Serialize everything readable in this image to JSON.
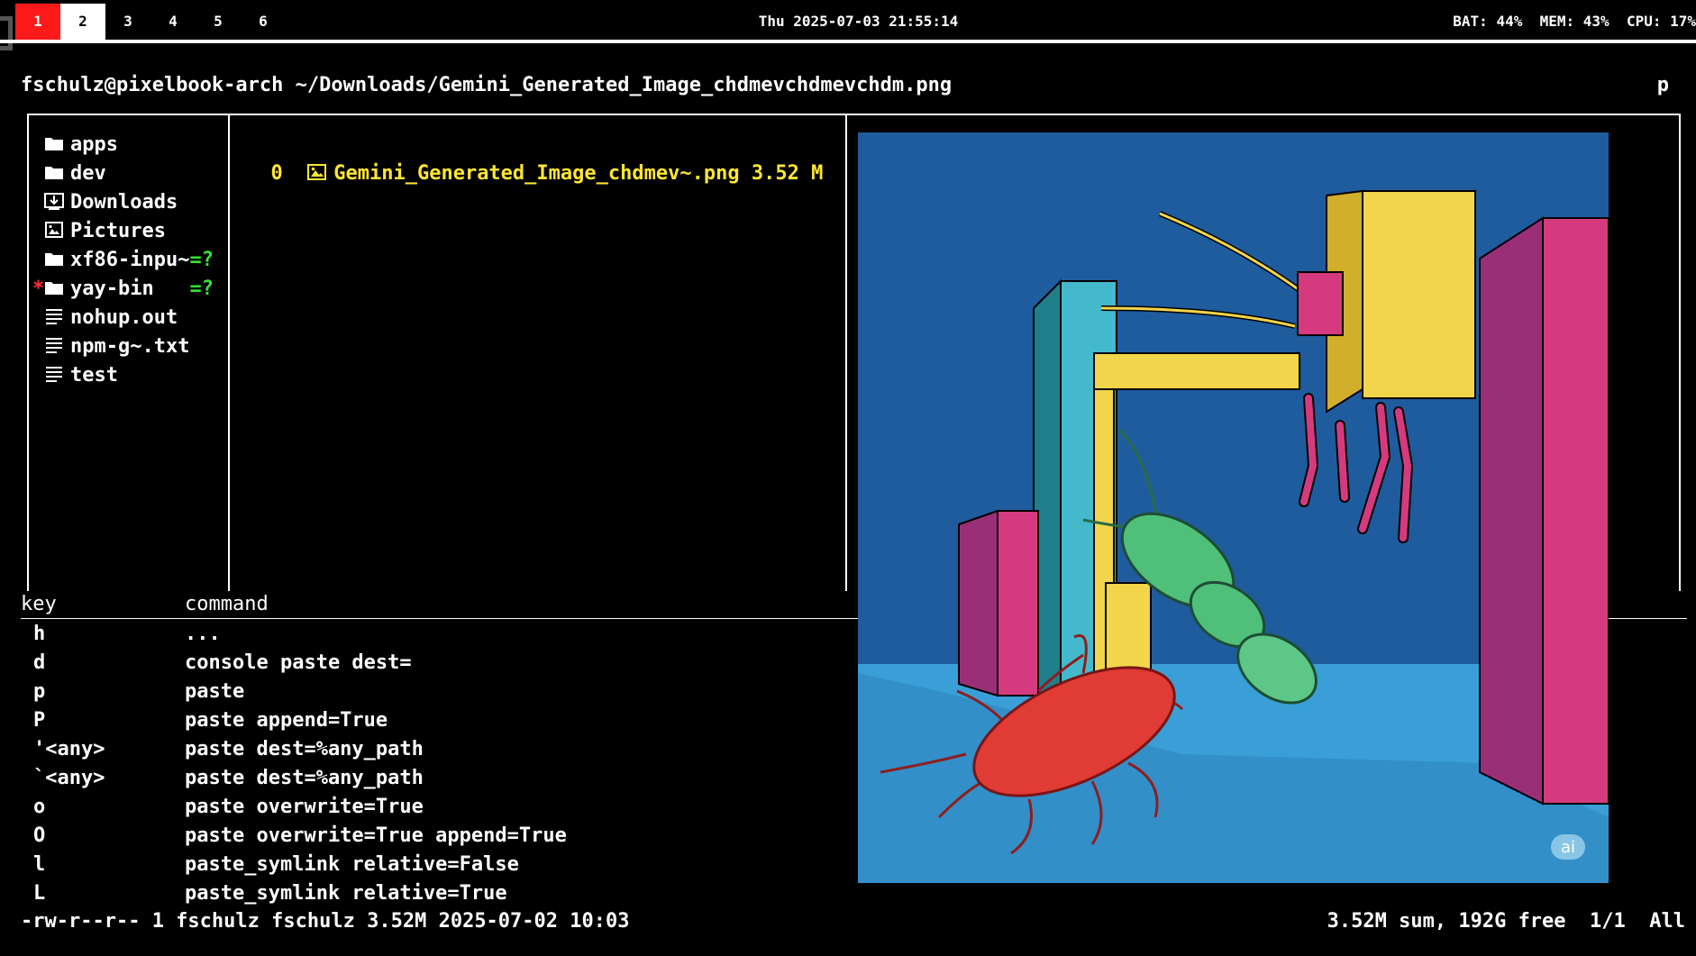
{
  "workspaces": [
    {
      "label": "1",
      "state": "active"
    },
    {
      "label": "2",
      "state": "visible"
    },
    {
      "label": "3",
      "state": "normal"
    },
    {
      "label": "4",
      "state": "normal"
    },
    {
      "label": "5",
      "state": "normal"
    },
    {
      "label": "6",
      "state": "normal"
    }
  ],
  "clock": "Thu 2025-07-03  21:55:14",
  "status": "BAT: 44%  MEM: 43%  CPU: 17%",
  "ranger": {
    "title": "fschulz@pixelbook-arch ~/Downloads/Gemini_Generated_Image_chdmevchdmevchdm.png",
    "title_right": "p",
    "parent_items": [
      {
        "name": "apps",
        "icon": "folder-icon",
        "suffix": "",
        "mark": ""
      },
      {
        "name": "dev",
        "icon": "folder-icon",
        "suffix": "",
        "mark": ""
      },
      {
        "name": "Downloads",
        "icon": "downloads-icon",
        "suffix": "",
        "mark": ""
      },
      {
        "name": "Pictures",
        "icon": "pictures-icon",
        "suffix": "",
        "mark": ""
      },
      {
        "name": "xf86-inpu~",
        "icon": "folder-icon",
        "suffix": "=?",
        "mark": ""
      },
      {
        "name": "yay-bin   ",
        "icon": "folder-icon",
        "suffix": "=?",
        "mark": "*"
      },
      {
        "name": "nohup.out",
        "icon": "text-file-icon",
        "suffix": "",
        "mark": ""
      },
      {
        "name": "npm-g~.txt",
        "icon": "text-file-icon",
        "suffix": "",
        "mark": ""
      },
      {
        "name": "test",
        "icon": "text-file-icon",
        "suffix": "",
        "mark": ""
      }
    ],
    "current": {
      "index": "0",
      "name": "Gemini_Generated_Image_chdmev~.png",
      "size": "3.52 M",
      "icon": "image-file-icon"
    },
    "help_header": {
      "key": "key",
      "command": "command"
    },
    "help_rows": [
      {
        "key": "h",
        "command": "..."
      },
      {
        "key": "d",
        "command": "console paste dest="
      },
      {
        "key": "p",
        "command": "paste"
      },
      {
        "key": "P",
        "command": "paste append=True"
      },
      {
        "key": "'<any>",
        "command": "paste dest=%any_path"
      },
      {
        "key": "`<any>",
        "command": "paste dest=%any_path"
      },
      {
        "key": "o",
        "command": "paste overwrite=True"
      },
      {
        "key": "O",
        "command": "paste overwrite=True append=True"
      },
      {
        "key": "l",
        "command": "paste_symlink relative=False"
      },
      {
        "key": "L",
        "command": "paste_symlink relative=True"
      }
    ],
    "footer_left": "-rw-r--r-- 1 fschulz fschulz 3.52M 2025-07-02 10:03",
    "footer_right": "3.52M sum, 192G free  1/1  All"
  },
  "preview": {
    "watermark": "ai",
    "colors": {
      "sky": "#1f5c9e",
      "floor": "#3a9fd6",
      "yellow": "#f2d54a",
      "magenta": "#d63a7e",
      "teal": "#45b9cc",
      "green": "#4fbf7a",
      "red": "#e03b34"
    }
  },
  "colors": {
    "active_ws": "#ff1a1a",
    "current_file": "#ffe633",
    "tag_mark": "#ff3030",
    "suffix": "#33e533"
  }
}
